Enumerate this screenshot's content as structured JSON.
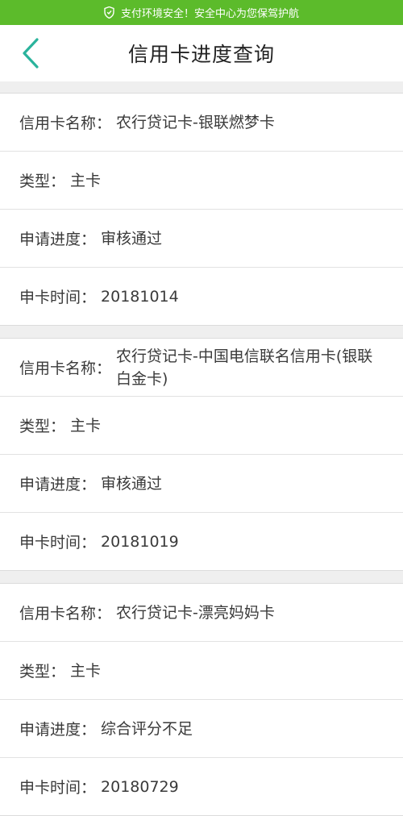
{
  "banner": {
    "text": "支付环境安全！安全中心为您保驾护航",
    "icon": "shield-icon",
    "color": "#5cbb2b"
  },
  "header": {
    "title": "信用卡进度查询",
    "back_icon": "chevron-left-icon",
    "accent": "#2ab39c"
  },
  "cards": [
    {
      "name_label": "信用卡名称：",
      "name_value": "农行贷记卡-银联燃梦卡",
      "type_label": "类型：",
      "type_value": "主卡",
      "progress_label": "申请进度：",
      "progress_value": "审核通过",
      "date_label": "申卡时间：",
      "date_value": "20181014"
    },
    {
      "name_label": "信用卡名称：",
      "name_value": "农行贷记卡-中国电信联名信用卡(银联白金卡)",
      "type_label": "类型：",
      "type_value": "主卡",
      "progress_label": "申请进度：",
      "progress_value": "审核通过",
      "date_label": "申卡时间：",
      "date_value": "20181019"
    },
    {
      "name_label": "信用卡名称：",
      "name_value": "农行贷记卡-漂亮妈妈卡",
      "type_label": "类型：",
      "type_value": "主卡",
      "progress_label": "申请进度：",
      "progress_value": "综合评分不足",
      "date_label": "申卡时间：",
      "date_value": "20180729"
    }
  ]
}
